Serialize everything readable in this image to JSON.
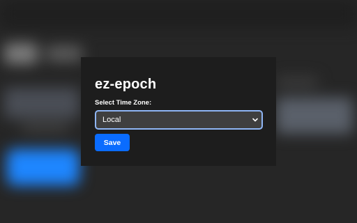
{
  "popup": {
    "title": "ez-epoch",
    "timezone_label": "Select Time Zone:",
    "timezone_selected": "Local",
    "save_label": "Save"
  },
  "colors": {
    "panel_bg": "#1d1d1d",
    "select_bg": "#3f3f3f",
    "select_focus_border": "#8fb6f5",
    "button_bg": "#0a6cff",
    "text": "#ffffff"
  },
  "icons": {
    "dropdown": "chevron-down-icon"
  }
}
